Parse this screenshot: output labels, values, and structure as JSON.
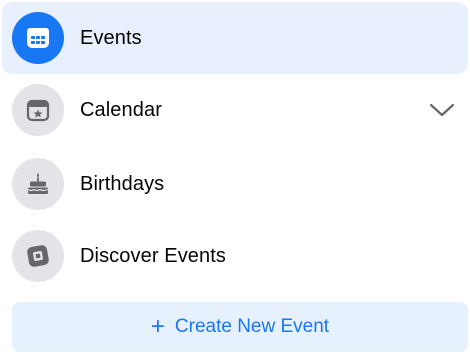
{
  "nav": {
    "items": [
      {
        "label": "Events",
        "icon": "calendar-grid-icon",
        "active": true
      },
      {
        "label": "Calendar",
        "icon": "calendar-star-icon",
        "active": false,
        "expandable": true
      },
      {
        "label": "Birthdays",
        "icon": "cake-icon",
        "active": false
      },
      {
        "label": "Discover Events",
        "icon": "compass-icon",
        "active": false
      }
    ]
  },
  "create_button": {
    "icon": "plus-icon",
    "symbol": "+",
    "label": "Create New Event"
  },
  "colors": {
    "accent": "#1877f2",
    "active_bg": "#e8f0fd",
    "icon_bg": "#e3e4e8",
    "icon_fg": "#65676b",
    "text": "#050505"
  }
}
